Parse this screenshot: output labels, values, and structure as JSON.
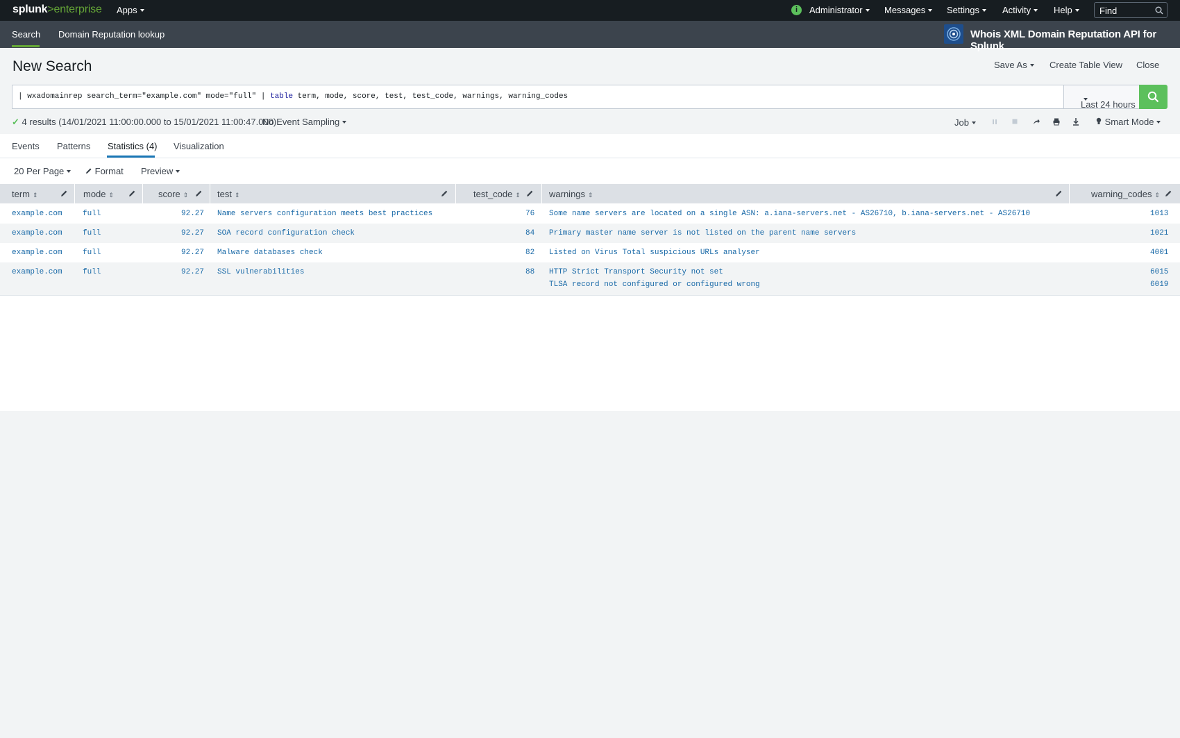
{
  "topbar": {
    "logo_splunk": "splunk",
    "logo_gt": ">",
    "logo_enterprise": "enterprise",
    "apps": "Apps",
    "info_glyph": "i",
    "administrator": "Administrator",
    "messages": "Messages",
    "settings": "Settings",
    "activity": "Activity",
    "help": "Help",
    "find_placeholder": "Find"
  },
  "appbar": {
    "tabs": [
      "Search",
      "Domain Reputation lookup"
    ],
    "app_title": "Whois XML Domain Reputation API for Splunk"
  },
  "header": {
    "title": "New Search",
    "save_as": "Save As",
    "create_table_view": "Create Table View",
    "close": "Close"
  },
  "search": {
    "query_prefix": "| wxadomainrep search_term=\"example.com\" mode=\"full\" | ",
    "query_keyword": "table",
    "query_suffix": " term, mode, score, test, test_code, warnings, warning_codes",
    "time_range": "Last 24 hours"
  },
  "status": {
    "check": "✓",
    "text": "4 results (14/01/2021 11:00:00.000 to 15/01/2021 11:00:47.000)",
    "sampling": "No Event Sampling",
    "job": "Job",
    "mode": "Smart Mode"
  },
  "result_tabs": [
    "Events",
    "Patterns",
    "Statistics (4)",
    "Visualization"
  ],
  "options": {
    "per_page": "20 Per Page",
    "format": "Format",
    "preview": "Preview"
  },
  "table": {
    "columns": [
      "term",
      "mode",
      "score",
      "test",
      "test_code",
      "warnings",
      "warning_codes"
    ],
    "rows": [
      {
        "term": "example.com",
        "mode": "full",
        "score": "92.27",
        "test": "Name servers configuration meets best practices",
        "test_code": "76",
        "warnings": [
          "Some name servers are located on a single ASN: a.iana-servers.net - AS26710, b.iana-servers.net - AS26710"
        ],
        "warning_codes": [
          "1013"
        ]
      },
      {
        "term": "example.com",
        "mode": "full",
        "score": "92.27",
        "test": "SOA record configuration check",
        "test_code": "84",
        "warnings": [
          "Primary master name server is not listed on the parent name servers"
        ],
        "warning_codes": [
          "1021"
        ]
      },
      {
        "term": "example.com",
        "mode": "full",
        "score": "92.27",
        "test": "Malware databases check",
        "test_code": "82",
        "warnings": [
          "Listed on Virus Total suspicious URLs analyser"
        ],
        "warning_codes": [
          "4001"
        ]
      },
      {
        "term": "example.com",
        "mode": "full",
        "score": "92.27",
        "test": "SSL vulnerabilities",
        "test_code": "88",
        "warnings": [
          "HTTP Strict Transport Security not set",
          "TLSA record not configured or configured wrong"
        ],
        "warning_codes": [
          "6015",
          "6019"
        ]
      }
    ]
  },
  "colors": {
    "topbar_bg": "#171d21",
    "appbar_bg": "#3c444d",
    "accent_green": "#5cc05c",
    "tab_blue": "#1a76b5",
    "cell_text": "#1a6aa8"
  }
}
